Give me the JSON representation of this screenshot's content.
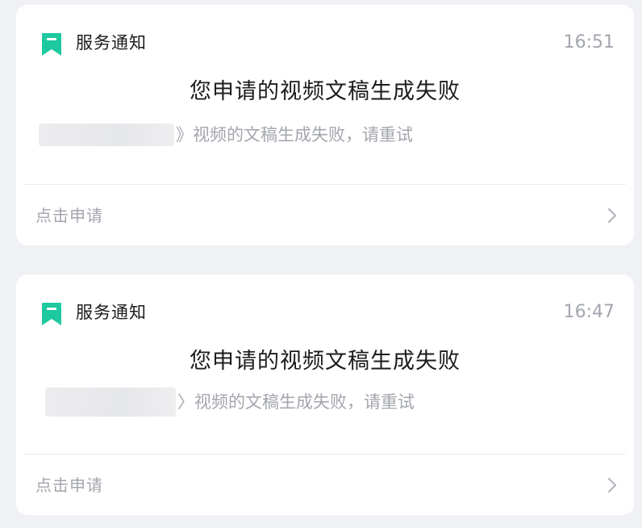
{
  "notifications": [
    {
      "service_name": "服务通知",
      "time": "16:51",
      "title": "您申请的视频文稿生成失败",
      "desc_prefix": "》",
      "description": "视频的文稿生成失败，请重试",
      "action_label": "点击申请",
      "icon": "bookmark-icon"
    },
    {
      "service_name": "服务通知",
      "time": "16:47",
      "title": "您申请的视频文稿生成失败",
      "desc_prefix": "〉",
      "description": "视频的文稿生成失败，请重试",
      "action_label": "点击申请",
      "icon": "bookmark-icon"
    }
  ],
  "colors": {
    "accent": "#1ec9a0",
    "background": "#f0f1f5",
    "card": "#ffffff",
    "secondary_text": "#a3a6ad",
    "primary_text": "#1c1c1e"
  }
}
